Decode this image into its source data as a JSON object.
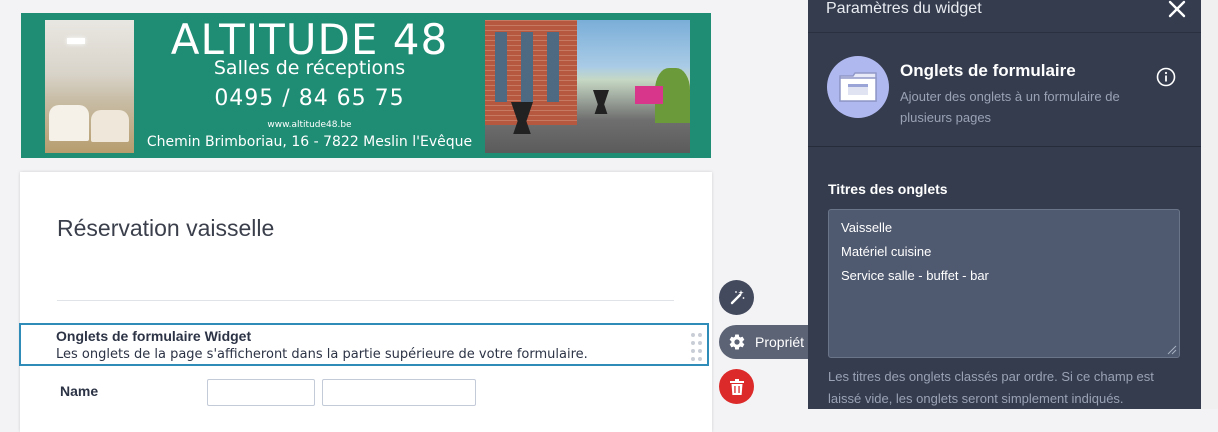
{
  "banner": {
    "title": "ALTITUDE 48",
    "subtitle": "Salles de réceptions",
    "phone": "0495 / 84 65 75",
    "website": "www.altitude48.be",
    "address": "Chemin Brimboriau, 16  - 7822 Meslin l'Evêque"
  },
  "form": {
    "title": "Réservation vaisselle",
    "widget": {
      "title": "Onglets de formulaire Widget",
      "description": "Les onglets de la page s'afficheront dans la partie supérieure de votre formulaire."
    },
    "name_label": "Name"
  },
  "actions": {
    "properties_label": "Propriét"
  },
  "panel": {
    "header_title": "Paramètres du widget",
    "widget_name": "Onglets de formulaire",
    "widget_description": "Ajouter des onglets à un formulaire de plusieurs pages",
    "tabs_label": "Titres des onglets",
    "tabs_lines": [
      "Vaisselle",
      "Matériel cuisine",
      "Service salle - buffet - bar"
    ],
    "tabs_help": "Les titres des onglets classés par ordre. Si ce champ est laissé vide, les onglets seront simplement indiqués."
  },
  "colors": {
    "banner_green": "#1f8c74",
    "panel_bg": "#343c4e",
    "selected_border": "#2f8cb8",
    "delete_red": "#dc2a2a",
    "widget_icon_bg": "#b0b8f0"
  },
  "icons": [
    "magic-wand-icon",
    "gear-icon",
    "trash-icon",
    "close-icon",
    "info-icon",
    "tabs-widget-icon",
    "drag-handle-icon",
    "resize-grip-icon"
  ]
}
